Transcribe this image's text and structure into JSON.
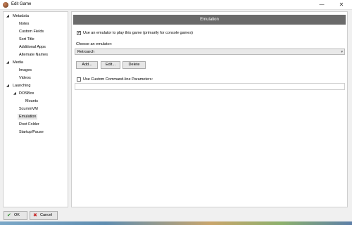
{
  "window": {
    "title": "Edit Game",
    "minimize_glyph": "—",
    "close_glyph": "✕"
  },
  "tree": {
    "sections": [
      {
        "label": "Metadata",
        "children": [
          "Notes",
          "Custom Fields",
          "Sort Title",
          "Additional Apps",
          "Alternate Names"
        ]
      },
      {
        "label": "Media",
        "children": [
          "Images",
          "Videos"
        ]
      },
      {
        "label": "Launching",
        "children": [
          "DOSBox",
          "Mounts",
          "ScummVM",
          "Emulation",
          "Root Folder",
          "Startup/Pause"
        ]
      }
    ],
    "selected": "Emulation"
  },
  "panel": {
    "header": "Emulation",
    "use_emulator_label": "Use an emulator to play this game (primarily for console games)",
    "use_emulator_checked": true,
    "choose_label": "Choose an emulator:",
    "emulator_value": "Retroarch",
    "add_label": "Add...",
    "edit_label": "Edit...",
    "delete_label": "Delete",
    "custom_params_label": "Use Custom Command-line Parameters:",
    "custom_params_checked": false,
    "custom_params_value": ""
  },
  "footer": {
    "ok_label": "OK",
    "cancel_label": "Cancel"
  },
  "icons": {
    "app": "game-icon",
    "ok": "check-icon",
    "cancel": "x-icon"
  },
  "colors": {
    "header_bg": "#6a6a6a",
    "ok_green": "#2e8b2e",
    "cancel_red": "#c62828"
  }
}
